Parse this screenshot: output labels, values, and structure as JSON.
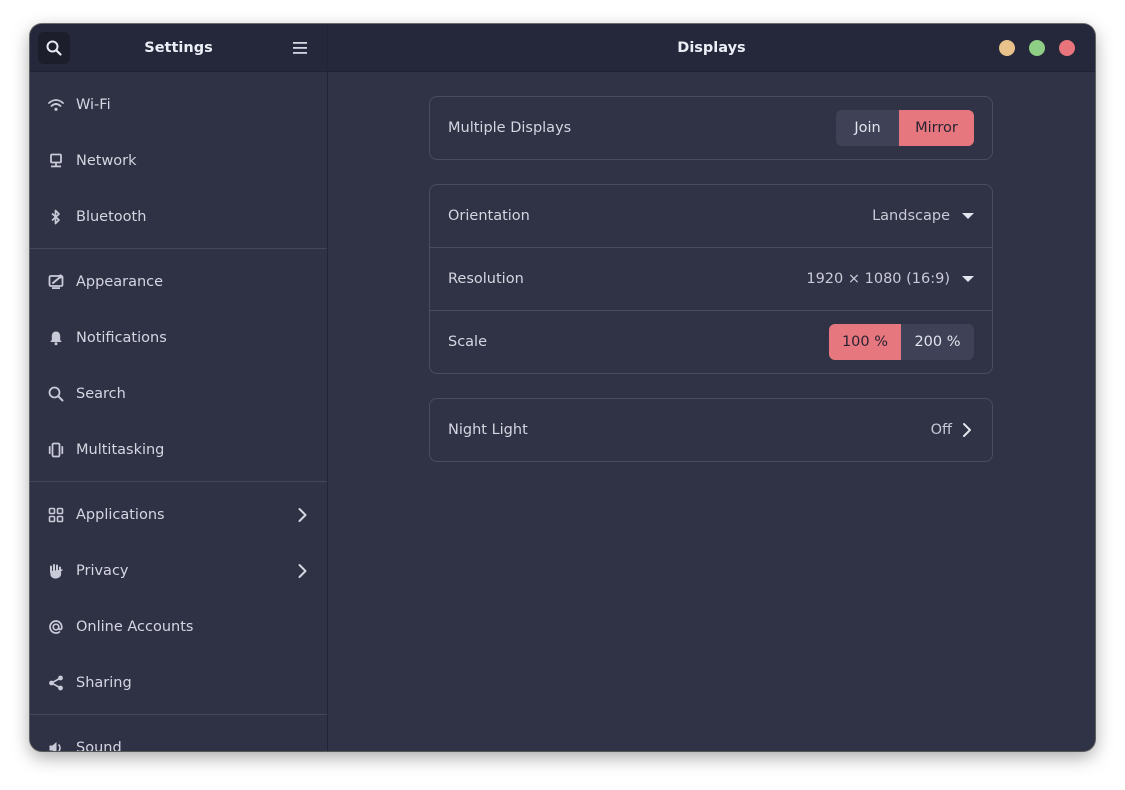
{
  "sidebar": {
    "title": "Settings",
    "search_icon": "search-icon",
    "menu_icon": "hamburger-menu-icon",
    "items": [
      {
        "label": "Wi-Fi",
        "icon": "wifi-icon"
      },
      {
        "label": "Network",
        "icon": "network-icon"
      },
      {
        "label": "Bluetooth",
        "icon": "bluetooth-icon"
      },
      {
        "label": "Appearance",
        "icon": "appearance-icon"
      },
      {
        "label": "Notifications",
        "icon": "bell-icon"
      },
      {
        "label": "Search",
        "icon": "search-icon"
      },
      {
        "label": "Multitasking",
        "icon": "multitasking-icon"
      },
      {
        "label": "Applications",
        "icon": "grid-icon",
        "has_submenu": true
      },
      {
        "label": "Privacy",
        "icon": "hand-icon",
        "has_submenu": true
      },
      {
        "label": "Online Accounts",
        "icon": "at-icon"
      },
      {
        "label": "Sharing",
        "icon": "share-icon"
      },
      {
        "label": "Sound",
        "icon": "speaker-icon"
      }
    ]
  },
  "header": {
    "title": "Displays"
  },
  "window_controls": {
    "minimize_color": "#e8c28a",
    "maximize_color": "#8fce85",
    "close_color": "#e8747c"
  },
  "displays": {
    "multiple_displays": {
      "label": "Multiple Displays",
      "options": [
        "Join",
        "Mirror"
      ],
      "selected": "Mirror"
    },
    "orientation": {
      "label": "Orientation",
      "value": "Landscape"
    },
    "resolution": {
      "label": "Resolution",
      "value": "1920 × 1080 (16:9)"
    },
    "scale": {
      "label": "Scale",
      "options": [
        "100 %",
        "200 %"
      ],
      "selected": "100 %"
    },
    "night_light": {
      "label": "Night Light",
      "value": "Off"
    }
  },
  "colors": {
    "accent": "#e6777f",
    "background": "#303245",
    "header": "#25273a"
  }
}
